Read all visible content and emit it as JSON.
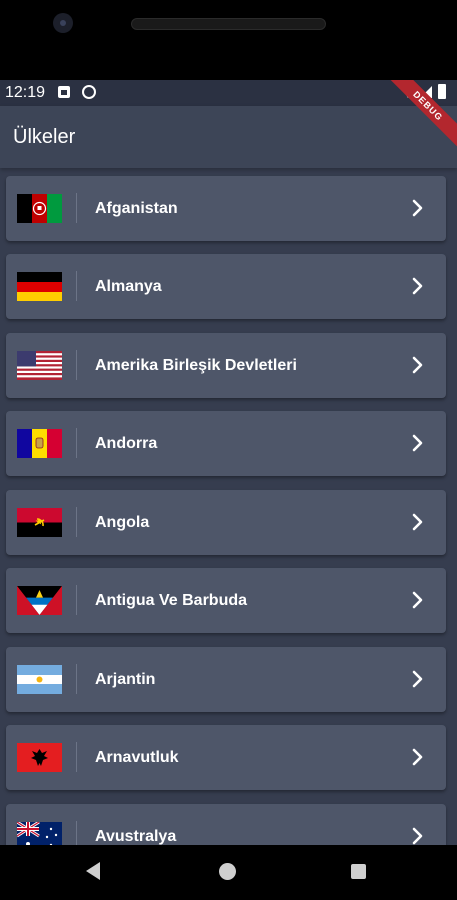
{
  "status_bar": {
    "time": "12:19"
  },
  "debug_banner": "DEBUG",
  "header": {
    "title": "Ülkeler"
  },
  "countries": [
    {
      "name": "Afganistan",
      "flag_icon": "flag-afghanistan-icon"
    },
    {
      "name": "Almanya",
      "flag_icon": "flag-germany-icon"
    },
    {
      "name": "Amerika Birleşik Devletleri",
      "flag_icon": "flag-usa-icon"
    },
    {
      "name": "Andorra",
      "flag_icon": "flag-andorra-icon"
    },
    {
      "name": "Angola",
      "flag_icon": "flag-angola-icon"
    },
    {
      "name": "Antigua Ve Barbuda",
      "flag_icon": "flag-antigua-barbuda-icon"
    },
    {
      "name": "Arjantin",
      "flag_icon": "flag-argentina-icon"
    },
    {
      "name": "Arnavutluk",
      "flag_icon": "flag-albania-icon"
    },
    {
      "name": "Avustralya",
      "flag_icon": "flag-australia-icon"
    }
  ],
  "colors": {
    "background": "#363d4f",
    "header": "#3d4557",
    "card": "#4e5669",
    "text": "#ffffff",
    "debug": "#b3272e"
  }
}
